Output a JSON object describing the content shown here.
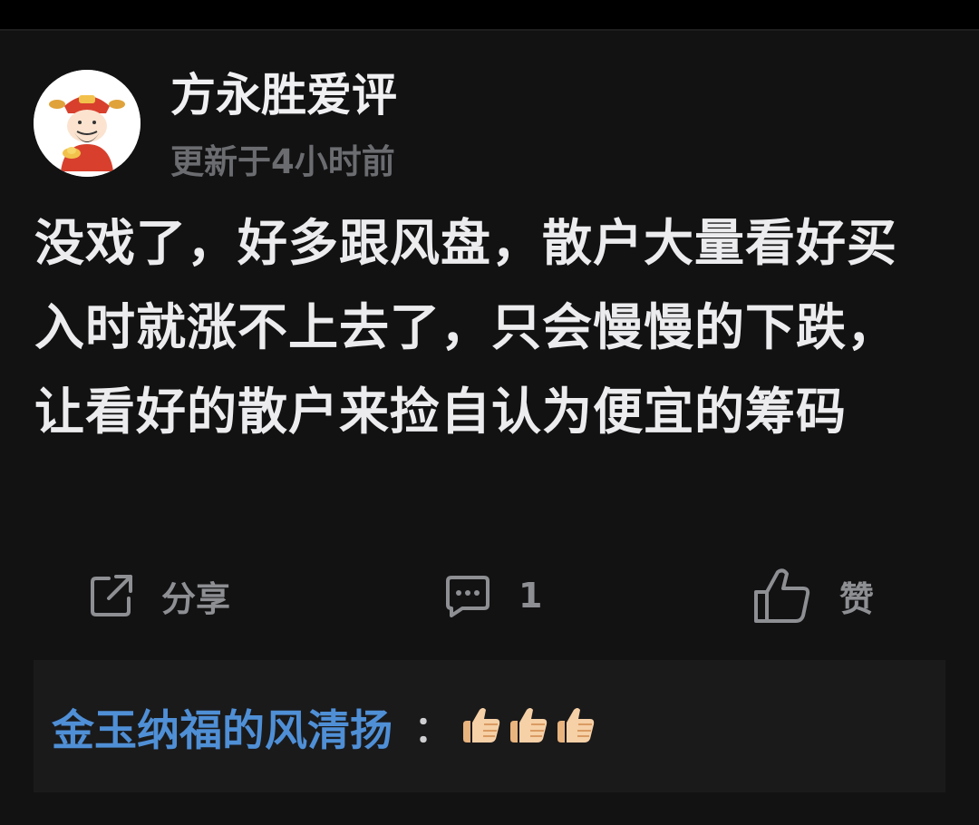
{
  "post": {
    "author": "方永胜爱评",
    "updated": "更新于4小时前",
    "content": "没戏了，好多跟风盘，散户大量看好买入时就涨不上去了，只会慢慢的下跌，让看好的散户来捡自认为便宜的筹码"
  },
  "actions": {
    "share_label": "分享",
    "comment_count": "1",
    "like_label": "赞"
  },
  "reply": {
    "user": "金玉纳福的风清扬",
    "separator": "：",
    "emojis": [
      "thumbs-up-icon",
      "thumbs-up-icon",
      "thumbs-up-icon"
    ]
  },
  "colors": {
    "background": "#121213",
    "link": "#4f8fd6",
    "muted": "#6b6c70",
    "icon": "#8e8f93"
  }
}
